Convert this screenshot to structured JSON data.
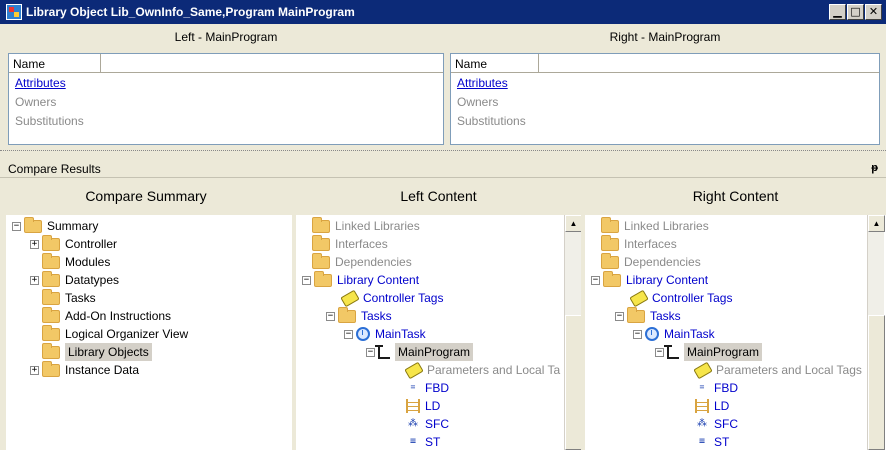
{
  "window": {
    "title": "Library Object Lib_OwnInfo_Same,Program MainProgram",
    "buttons": {
      "minimize": "▁",
      "restore": "□",
      "close": "✕"
    }
  },
  "left_pane": {
    "header": "Left - MainProgram",
    "column": "Name",
    "items": [
      "Attributes",
      "Owners",
      "Substitutions"
    ]
  },
  "right_pane": {
    "header": "Right - MainProgram",
    "column": "Name",
    "items": [
      "Attributes",
      "Owners",
      "Substitutions"
    ]
  },
  "compare_results": {
    "label": "Compare Results",
    "pin": "ᵽ"
  },
  "columns": {
    "summary": "Compare Summary",
    "left": "Left Content",
    "right": "Right Content"
  },
  "summary_tree": [
    "Summary",
    "Controller",
    "Modules",
    "Datatypes",
    "Tasks",
    "Add-On Instructions",
    "Logical Organizer View",
    "Library Objects",
    "Instance Data"
  ],
  "content_tree": {
    "linked_libraries": "Linked Libraries",
    "interfaces": "Interfaces",
    "dependencies": "Dependencies",
    "library_content": "Library Content",
    "controller_tags": "Controller Tags",
    "tasks": "Tasks",
    "main_task": "MainTask",
    "main_program": "MainProgram",
    "params_left": "Parameters and Local Ta",
    "params_right": "Parameters and Local Tags",
    "fbd": "FBD",
    "ld": "LD",
    "sfc": "SFC",
    "st": "ST"
  },
  "colors": {
    "link": "#0000cc",
    "title_bar": "#0c2a78",
    "muted": "#8a8a8a"
  }
}
